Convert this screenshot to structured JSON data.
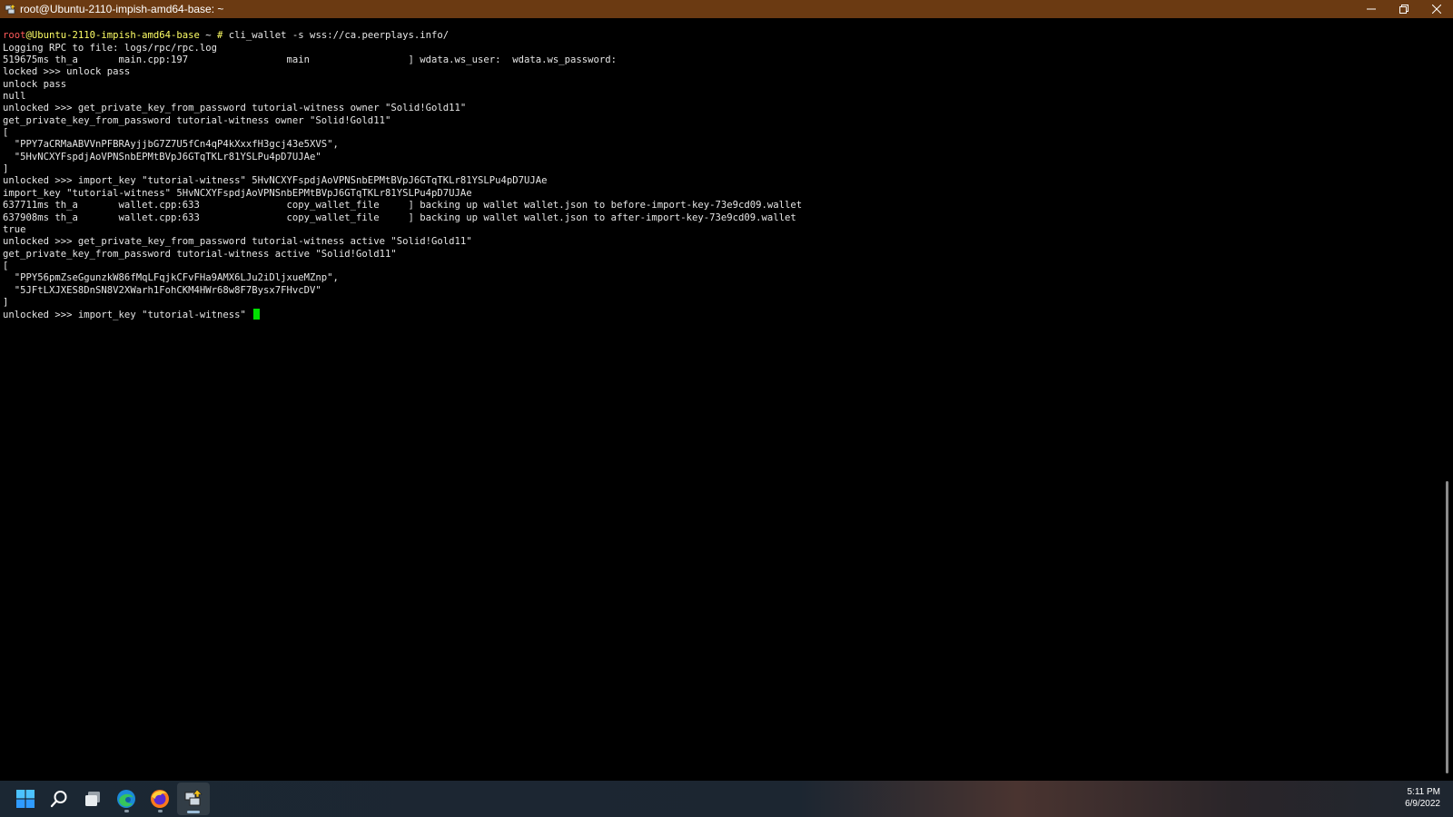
{
  "window": {
    "title": "root@Ubuntu-2110-impish-amd64-base: ~",
    "icon": "putty-terminal-icon",
    "controls": [
      "minimize-icon",
      "restore-icon",
      "close-icon"
    ]
  },
  "terminal": {
    "prompt": {
      "user": "root",
      "host": "@Ubuntu-2110-impish-amd64-base",
      "path": " ~ ",
      "symbol": "#",
      "command": " cli_wallet -s wss://ca.peerplays.info/"
    },
    "lines": [
      "Logging RPC to file: logs/rpc/rpc.log",
      "519675ms th_a       main.cpp:197                 main                 ] wdata.ws_user:  wdata.ws_password:",
      "locked >>> unlock pass",
      "unlock pass",
      "null",
      "unlocked >>> get_private_key_from_password tutorial-witness owner \"Solid!Gold11\"",
      "get_private_key_from_password tutorial-witness owner \"Solid!Gold11\"",
      "[",
      "  \"PPY7aCRMaABVVnPFBRAyjjbG7Z7U5fCn4qP4kXxxfH3gcj43e5XVS\",",
      "  \"5HvNCXYFspdjAoVPNSnbEPMtBVpJ6GTqTKLr81YSLPu4pD7UJAe\"",
      "]",
      "unlocked >>> import_key \"tutorial-witness\" 5HvNCXYFspdjAoVPNSnbEPMtBVpJ6GTqTKLr81YSLPu4pD7UJAe",
      "import_key \"tutorial-witness\" 5HvNCXYFspdjAoVPNSnbEPMtBVpJ6GTqTKLr81YSLPu4pD7UJAe",
      "637711ms th_a       wallet.cpp:633               copy_wallet_file     ] backing up wallet wallet.json to before-import-key-73e9cd09.wallet",
      "637908ms th_a       wallet.cpp:633               copy_wallet_file     ] backing up wallet wallet.json to after-import-key-73e9cd09.wallet",
      "true",
      "unlocked >>> get_private_key_from_password tutorial-witness active \"Solid!Gold11\"",
      "get_private_key_from_password tutorial-witness active \"Solid!Gold11\"",
      "[",
      "  \"PPY56pmZseGgunzkW86fMqLFqjkCFvFHa9AMX6LJu2iDljxueMZnp\",",
      "  \"5JFtLXJXES8DnSN8V2XWarh1FohCKM4HWr68w8F7Bysx7FHvcDV\"",
      "]"
    ],
    "current_input": "unlocked >>> import_key \"tutorial-witness\" "
  },
  "taskbar": {
    "items": [
      {
        "name": "start-button",
        "icon": "windows-logo-icon"
      },
      {
        "name": "search-button",
        "icon": "search-icon"
      },
      {
        "name": "task-view-button",
        "icon": "task-view-icon"
      },
      {
        "name": "edge-button",
        "icon": "edge-browser-icon"
      },
      {
        "name": "firefox-button",
        "icon": "firefox-icon"
      },
      {
        "name": "putty-button",
        "icon": "putty-icon"
      }
    ],
    "clock": {
      "time": "5:11 PM",
      "date": "6/9/2022"
    }
  }
}
